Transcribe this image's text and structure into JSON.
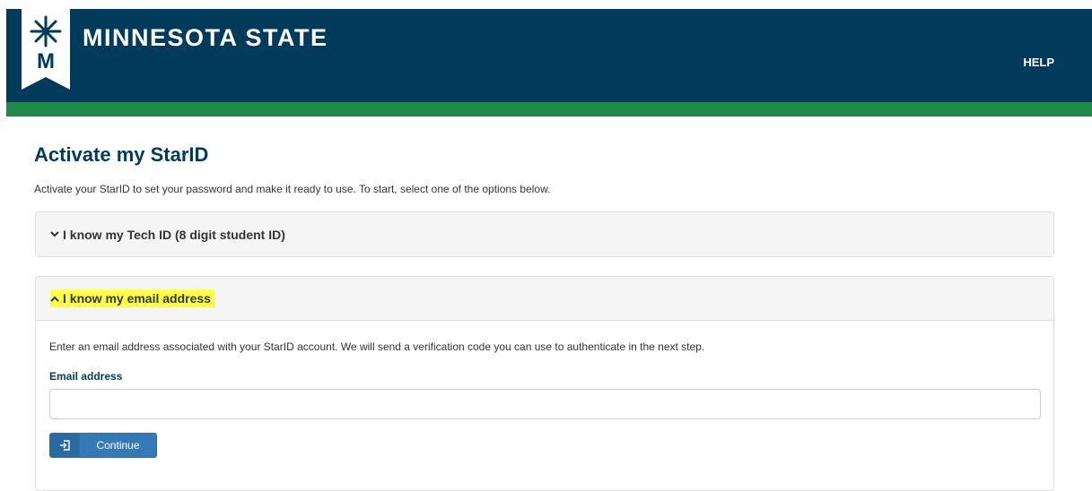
{
  "header": {
    "logo_text": "MINNESOTA STATE",
    "logo_initial": "M",
    "help_label": "HELP",
    "colors": {
      "brand_blue": "#003b5c",
      "brand_green": "#1f8a48"
    }
  },
  "page": {
    "title": "Activate my StarID",
    "intro": "Activate your StarID to set your password and make it ready to use. To start, select one of the options below."
  },
  "panels": {
    "techid": {
      "chevron": "chevron-down-icon",
      "label": "I know my Tech ID (8 digit student ID)",
      "expanded": false
    },
    "email": {
      "chevron": "chevron-up-icon",
      "label": "I know my email address",
      "expanded": true,
      "description": "Enter an email address associated with your StarID account. We will send a verification code you can use to authenticate in the next step.",
      "field_label": "Email address",
      "field_value": "",
      "field_placeholder": "",
      "button_label": "Continue",
      "button_icon": "sign-in-icon"
    }
  }
}
